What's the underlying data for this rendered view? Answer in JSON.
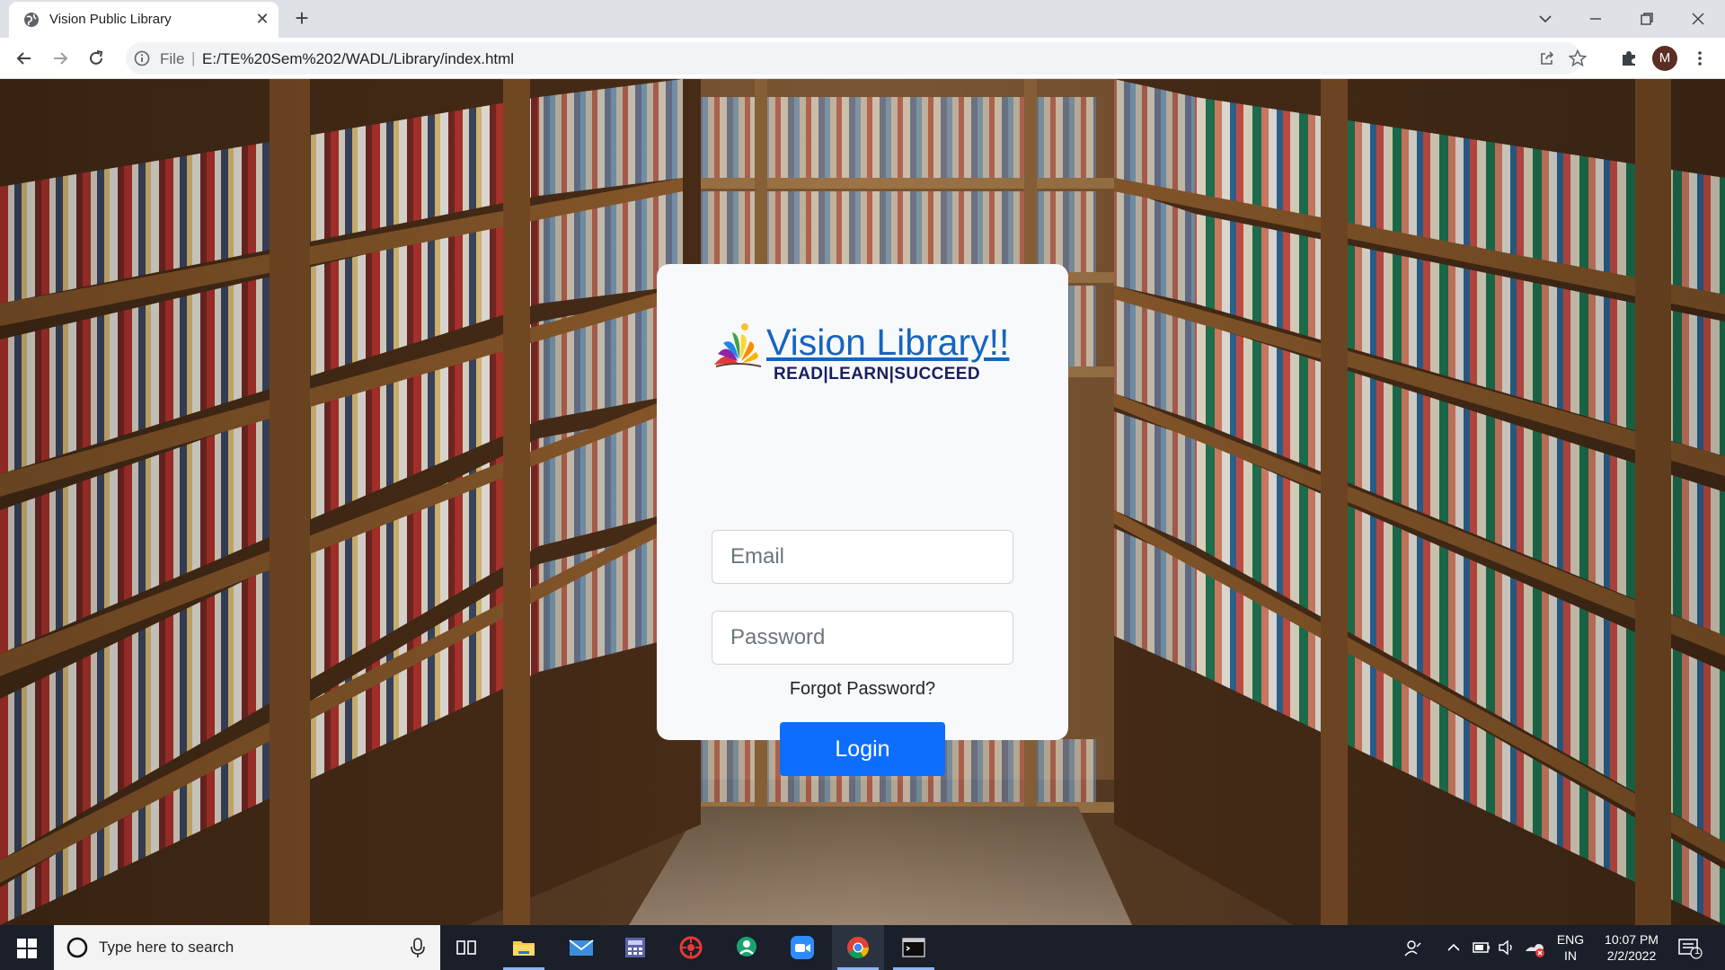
{
  "browser": {
    "tab_title": "Vision Public Library",
    "new_tab_symbol": "+",
    "close_symbol": "✕",
    "url_scheme": "File",
    "url_separator": "|",
    "url": "E:/TE%20Sem%202/WADL/Library/index.html",
    "profile_initial": "M"
  },
  "login": {
    "brand_name": "Vision Library!!",
    "tagline": "READ|LEARN|SUCCEED",
    "email_placeholder": "Email",
    "password_placeholder": "Password",
    "forgot_password": "Forgot Password?",
    "login_label": "Login",
    "accent_color": "#0d6efd",
    "brand_color": "#1565c0"
  },
  "taskbar": {
    "search_placeholder": "Type here to search",
    "lang_primary": "ENG",
    "lang_secondary": "IN",
    "time": "10:07 PM",
    "date": "2/2/2022",
    "notification_count": "1",
    "apps": [
      "task-view",
      "file-explorer",
      "mail",
      "calculator",
      "app-red",
      "app-green",
      "zoom",
      "chrome",
      "terminal"
    ]
  }
}
